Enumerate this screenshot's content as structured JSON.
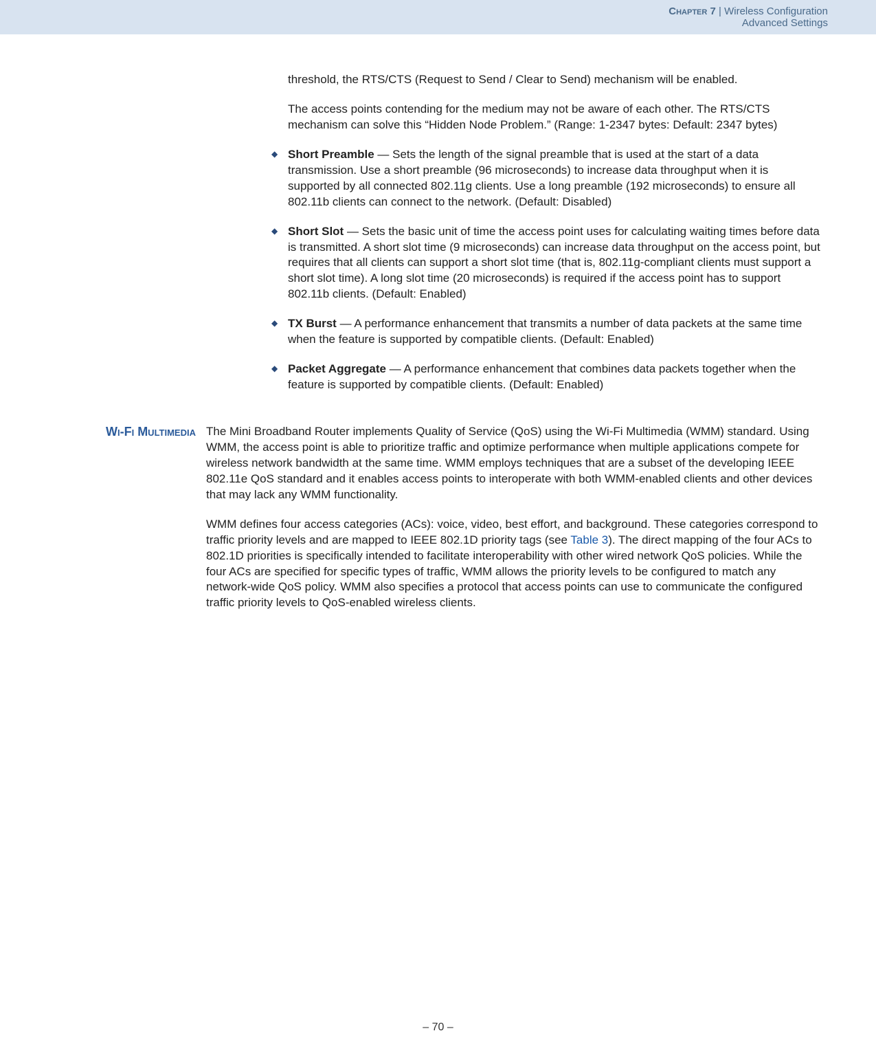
{
  "header": {
    "chapter_label": "Chapter 7",
    "separator": " | ",
    "chapter_title": "Wireless Configuration",
    "subtitle": "Advanced Settings"
  },
  "intro_paragraphs": [
    "threshold, the RTS/CTS (Request to Send / Clear to Send) mechanism will be enabled.",
    "The access points contending for the medium may not be aware of each other. The RTS/CTS mechanism can solve this “Hidden Node Problem.” (Range: 1-2347 bytes: Default: 2347 bytes)"
  ],
  "bullets": [
    {
      "term": "Short Preamble",
      "desc": " — Sets the length of the signal preamble that is used at the start of a data transmission. Use a short preamble (96 microseconds) to increase data throughput when it is supported by all connected 802.11g clients. Use a long preamble (192 microseconds) to ensure all 802.11b clients can connect to the network. (Default: Disabled)"
    },
    {
      "term": "Short Slot",
      "desc": " — Sets the basic unit of time the access point uses for calculating waiting times before data is transmitted. A short slot time (9 microseconds) can increase data throughput on the access point, but requires that all clients can support a short slot time (that is, 802.11g-compliant clients must support a short slot time). A long slot time (20 microseconds) is required if the access point has to support 802.11b clients. (Default: Enabled)"
    },
    {
      "term": "TX Burst",
      "desc": " — A performance enhancement that transmits a number of data packets at the same time when the feature is supported by compatible clients. (Default: Enabled)"
    },
    {
      "term": "Packet Aggregate",
      "desc": " — A performance enhancement that combines data packets together when the feature is supported by compatible clients. (Default: Enabled)"
    }
  ],
  "section": {
    "label": "Wi-Fi Multimedia",
    "para1": "The Mini Broadband Router implements Quality of Service (QoS) using the Wi-Fi Multimedia (WMM) standard. Using WMM, the access point is able to prioritize traffic and optimize performance when multiple applications compete for wireless network bandwidth at the same time. WMM employs techniques that are a subset of the developing IEEE 802.11e QoS standard and it enables access points to interoperate with both WMM-enabled clients and other devices that may lack any WMM functionality.",
    "para2_a": "WMM defines four access categories (ACs): voice, video, best effort, and background. These categories correspond to traffic priority levels and are mapped to IEEE 802.1D priority tags (see ",
    "para2_link": "Table 3",
    "para2_b": "). The direct mapping of the four ACs to 802.1D priorities is specifically intended to facilitate interoperability with other wired network QoS policies. While the four ACs are specified for specific types of traffic, WMM allows the priority levels to be configured to match any network-wide QoS policy. WMM also specifies a protocol that access points can use to communicate the configured traffic priority levels to QoS-enabled wireless clients."
  },
  "footer": {
    "page": "–  70  –"
  }
}
